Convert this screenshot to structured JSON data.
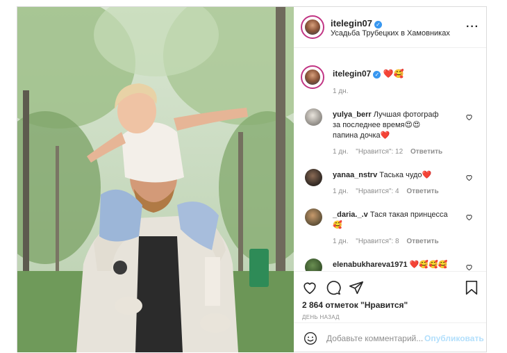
{
  "post": {
    "username": "itelegin07",
    "location": "Усадьба Трубецких в Хамовниках"
  },
  "caption": {
    "username": "itelegin07",
    "text": "❤️🥰",
    "age": "1 дн."
  },
  "comments": [
    {
      "username": "yulya_berr",
      "text": "Лучшая фотография за последнее время😍😍 папина дочка❤️",
      "line1": "Лучшая фотограф",
      "line2": "за последнее время😍😍",
      "line3": "папина дочка❤️",
      "age": "1 дн.",
      "likes": "\"Нравится\": 12",
      "reply": "Ответить"
    },
    {
      "username": "yanaa_nstrv",
      "text": "Таська чудо❤️",
      "age": "1 дн.",
      "likes": "\"Нравится\": 4",
      "reply": "Ответить"
    },
    {
      "username": "_daria._.v",
      "text": "Тася такая принцесса",
      "line2": "🥰",
      "age": "1 дн.",
      "likes": "\"Нравится\": 8",
      "reply": "Ответить"
    },
    {
      "username": "elenabukhareva1971",
      "text": "❤️🥰🥰🥰"
    }
  ],
  "likes_count": "2 864 отметок \"Нравится\"",
  "time_ago": "ДЕНЬ НАЗАД",
  "add_comment": {
    "placeholder": "Добавьте комментарий...",
    "publish": "Опубликовать"
  },
  "icons": {
    "verified": "verified-badge-icon",
    "more": "more-dots-icon",
    "like": "heart-icon",
    "comment": "comment-bubble-icon",
    "share": "paper-plane-icon",
    "save": "bookmark-icon",
    "emoji": "smiley-icon"
  },
  "colors": {
    "accent": "#3897f0",
    "publish_disabled": "#b2dffc",
    "muted": "#8e8e8e",
    "story_ring": "#c13584"
  }
}
